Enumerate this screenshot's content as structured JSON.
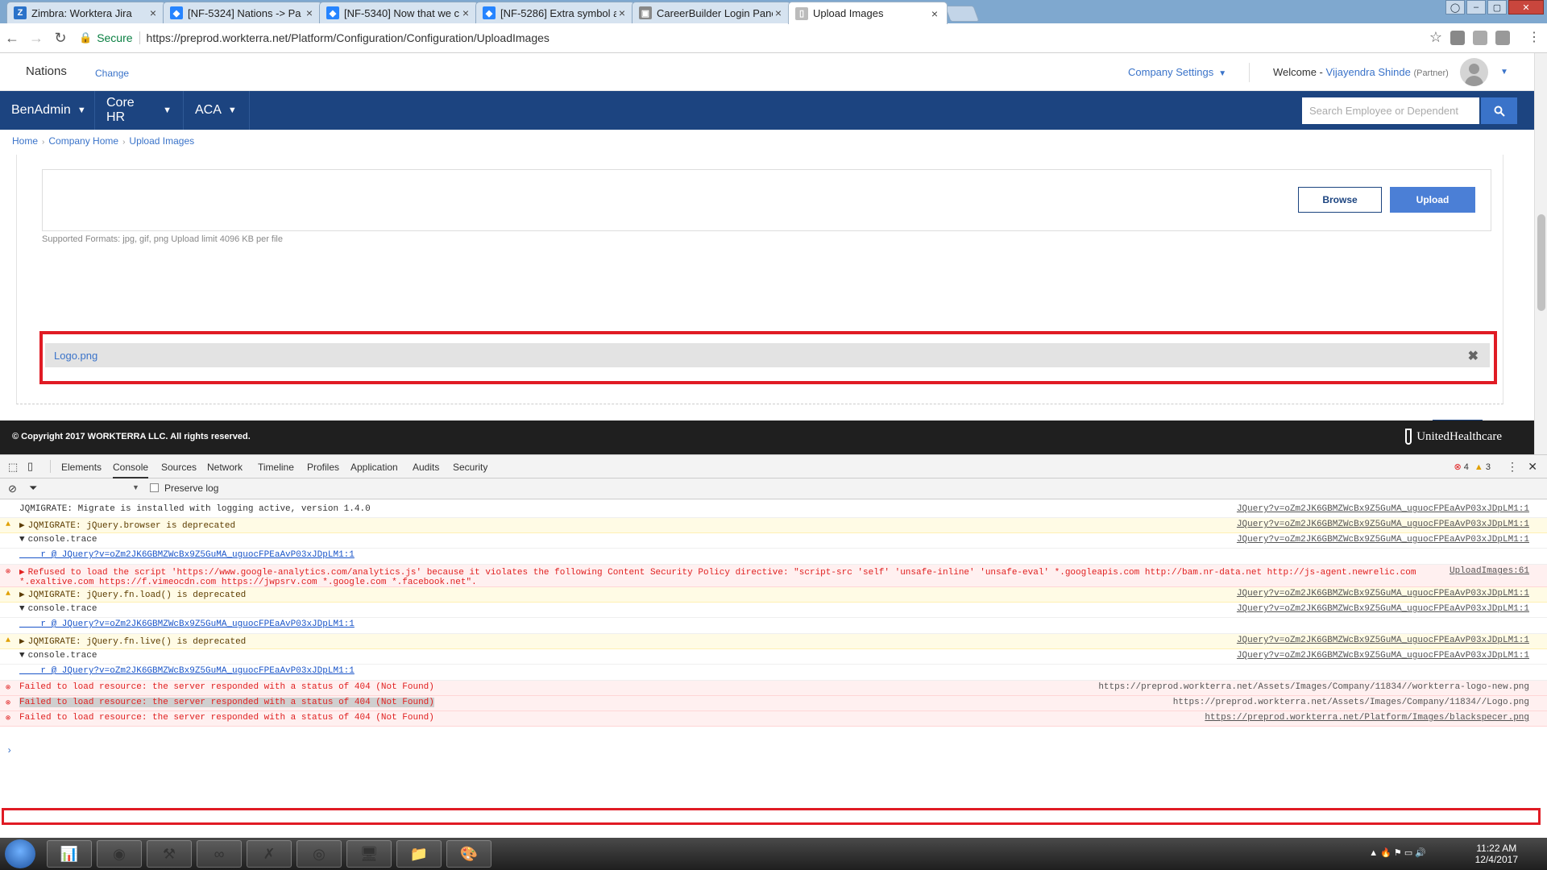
{
  "browser": {
    "tabs": [
      {
        "title": "Zimbra: Worktera Jira",
        "icon": "zimbra-icon",
        "color": "#2a72c9",
        "glyph": "Z"
      },
      {
        "title": "[NF-5324] Nations -> Pa",
        "icon": "jira-icon",
        "color": "#2684ff",
        "glyph": "◆"
      },
      {
        "title": "[NF-5340] Now that we c",
        "icon": "jira-icon",
        "color": "#2684ff",
        "glyph": "◆"
      },
      {
        "title": "[NF-5286] Extra symbol a",
        "icon": "jira-icon",
        "color": "#2684ff",
        "glyph": "◆"
      },
      {
        "title": "CareerBuilder Login Pane",
        "icon": "page-icon",
        "color": "#888888",
        "glyph": "▣"
      },
      {
        "title": "Upload Images",
        "icon": "document-icon",
        "color": "#bbbbbb",
        "glyph": "▯"
      }
    ],
    "secure_label": "Secure",
    "url": "https://preprod.workterra.net/Platform/Configuration/Configuration/UploadImages"
  },
  "header": {
    "company": "Nations",
    "change_label": "Change",
    "company_settings": "Company Settings",
    "welcome": "Welcome -",
    "user_name": "Vijayendra Shinde",
    "user_role": "(Partner)"
  },
  "nav": {
    "items": [
      "BenAdmin",
      "Core HR",
      "ACA"
    ],
    "search_placeholder": "Search Employee or Dependent"
  },
  "breadcrumb": [
    "Home",
    "Company Home",
    "Upload Images"
  ],
  "upload": {
    "browse_label": "Browse",
    "upload_label": "Upload",
    "formats_text": "Supported Formats: jpg, gif, png Upload limit 4096 KB per file",
    "file_name": "Logo.png"
  },
  "footer": {
    "copyright": "© Copyright 2017 WORKTERRA LLC. All rights reserved.",
    "brand": "UnitedHealthcare"
  },
  "devtools": {
    "tabs": [
      "Elements",
      "Console",
      "Sources",
      "Network",
      "Timeline",
      "Profiles",
      "Application",
      "Audits",
      "Security"
    ],
    "active_tab": "Console",
    "error_count": "4",
    "warning_count": "3",
    "preserve_log": "Preserve log",
    "log": [
      {
        "level": "info",
        "prefix": "",
        "text": "JQMIGRATE: Migrate is installed with logging active, version 1.4.0",
        "source": "JQuery?v=oZm2JK6GBMZWcBx9Z5GuMA_uguocFPEaAvP03xJDpLM1:1"
      },
      {
        "level": "warn",
        "prefix": "▶",
        "text": "JQMIGRATE: jQuery.browser is deprecated",
        "source": "JQuery?v=oZm2JK6GBMZWcBx9Z5GuMA_uguocFPEaAvP03xJDpLM1:1"
      },
      {
        "level": "info",
        "prefix": "▼",
        "text": "console.trace",
        "source": "JQuery?v=oZm2JK6GBMZWcBx9Z5GuMA_uguocFPEaAvP03xJDpLM1:1"
      },
      {
        "level": "info",
        "prefix": "",
        "text": "    r @ JQuery?v=oZm2JK6GBMZWcBx9Z5GuMA_uguocFPEaAvP03xJDpLM1:1",
        "source": ""
      },
      {
        "level": "err",
        "prefix": "▶",
        "text": "Refused to load the script 'https://www.google-analytics.com/analytics.js' because it violates the following Content Security Policy directive: \"script-src 'self'  'unsafe-inline' 'unsafe-eval' *.googleapis.com http://bam.nr-data.net http://js-agent.newrelic.com",
        "text2": "*.exaltive.com https://f.vimeocdn.com https://jwpsrv.com *.google.com *.facebook.net\".",
        "source": "UploadImages:61"
      },
      {
        "level": "warn",
        "prefix": "▶",
        "text": "JQMIGRATE: jQuery.fn.load() is deprecated",
        "source": "JQuery?v=oZm2JK6GBMZWcBx9Z5GuMA_uguocFPEaAvP03xJDpLM1:1"
      },
      {
        "level": "info",
        "prefix": "▼",
        "text": "console.trace",
        "source": "JQuery?v=oZm2JK6GBMZWcBx9Z5GuMA_uguocFPEaAvP03xJDpLM1:1"
      },
      {
        "level": "info",
        "prefix": "",
        "text": "    r @ JQuery?v=oZm2JK6GBMZWcBx9Z5GuMA_uguocFPEaAvP03xJDpLM1:1",
        "source": ""
      },
      {
        "level": "warn",
        "prefix": "▶",
        "text": "JQMIGRATE: jQuery.fn.live() is deprecated",
        "source": "JQuery?v=oZm2JK6GBMZWcBx9Z5GuMA_uguocFPEaAvP03xJDpLM1:1"
      },
      {
        "level": "info",
        "prefix": "▼",
        "text": "console.trace",
        "source": "JQuery?v=oZm2JK6GBMZWcBx9Z5GuMA_uguocFPEaAvP03xJDpLM1:1"
      },
      {
        "level": "info",
        "prefix": "",
        "text": "    r @ JQuery?v=oZm2JK6GBMZWcBx9Z5GuMA_uguocFPEaAvP03xJDpLM1:1",
        "source": ""
      },
      {
        "level": "err",
        "prefix": "",
        "text": "Failed to load resource: the server responded with a status of 404 (Not Found)",
        "source": "https://preprod.workterra.net/Assets/Images/Company/11834//workterra-logo-new.png"
      },
      {
        "level": "err",
        "prefix": "",
        "text": "Failed to load resource: the server responded with a status of 404 (Not Found)",
        "source": "https://preprod.workterra.net/Assets/Images/Company/11834//Logo.png",
        "highlight": true
      },
      {
        "level": "err",
        "prefix": "",
        "text": "Failed to load resource: the server responded with a status of 404 (Not Found)",
        "source": "https://preprod.workterra.net/Platform/Images/blackspecer.png"
      }
    ]
  },
  "taskbar": {
    "time": "11:22 AM",
    "date": "12/4/2017"
  }
}
